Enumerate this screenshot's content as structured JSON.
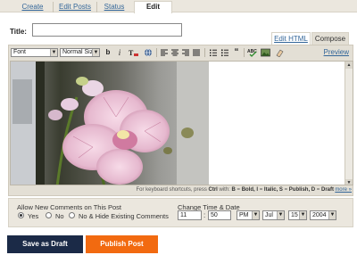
{
  "top_tabs": [
    {
      "label": "Create"
    },
    {
      "label": "Edit Posts"
    },
    {
      "label": "Status"
    },
    {
      "label": "Edit"
    }
  ],
  "title": {
    "label": "Title:",
    "value": ""
  },
  "mode_tabs": {
    "edit_html": "Edit HTML",
    "compose": "Compose"
  },
  "toolbar": {
    "font_select": "Font",
    "size_select": "Normal Size",
    "bold": "b",
    "italic": "i",
    "preview": "Preview",
    "icons": [
      "text-color-icon",
      "link-icon",
      "align-left-icon",
      "align-center-icon",
      "align-right-icon",
      "align-justify-icon",
      "numbered-list-icon",
      "bulleted-list-icon",
      "blockquote-icon",
      "spellcheck-icon",
      "image-icon",
      "remove-formatting-icon"
    ]
  },
  "content": {
    "image": "pink orchid flower photo"
  },
  "shortcuts": {
    "prefix": "For keyboard shortcuts, press",
    "key": "Ctrl",
    "with": "with:",
    "b": "B",
    "bold": "Bold,",
    "i": "I",
    "italic": "Italic,",
    "s": "S",
    "publish": "Publish,",
    "d": "D",
    "draft": "Draft",
    "more": "more »"
  },
  "comments": {
    "label": "Allow New Comments on This Post",
    "options": [
      "Yes",
      "No",
      "No & Hide Existing Comments"
    ],
    "selected": "Yes"
  },
  "time": {
    "label": "Change Time & Date",
    "hour": "11",
    "minute": "50",
    "ampm": "PM",
    "month": "Jul",
    "day": "15",
    "year": "2004"
  },
  "buttons": {
    "save_draft": "Save as Draft",
    "publish": "Publish Post"
  },
  "colors": {
    "draft_button": "#1b2a47",
    "publish_button": "#f26a10",
    "link": "#336699",
    "panel": "#ebe7de"
  }
}
